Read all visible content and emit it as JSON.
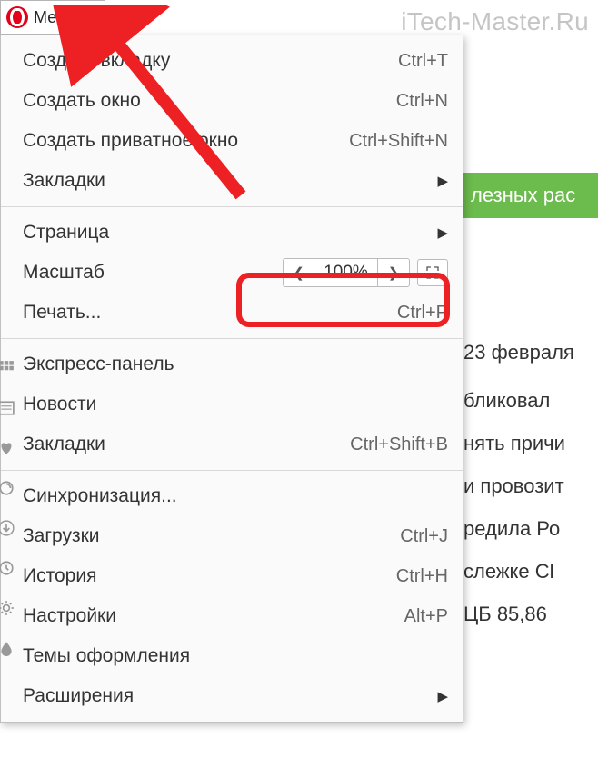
{
  "watermark": "iTech-Master.Ru",
  "menuButton": {
    "label": "Меню"
  },
  "background": {
    "banner": "лезных рас",
    "date": "23 февраля",
    "fragments": [
      "бликовал",
      "нять причи",
      "и провозит",
      "редила Ро",
      "слежке Cl",
      "ЦБ 85,86"
    ]
  },
  "menu": {
    "group1": [
      {
        "label": "Создать вкладку",
        "shortcut": "Ctrl+T"
      },
      {
        "label": "Создать окно",
        "shortcut": "Ctrl+N"
      },
      {
        "label": "Создать приватное окно",
        "shortcut": "Ctrl+Shift+N"
      },
      {
        "label": "Закладки",
        "submenu": true
      }
    ],
    "group2": {
      "page": {
        "label": "Страница",
        "submenu": true
      },
      "zoom": {
        "label": "Масштаб",
        "value": "100%"
      },
      "print": {
        "label": "Печать...",
        "shortcut": "Ctrl+P"
      }
    },
    "group3": [
      {
        "label": "Экспресс-панель",
        "icon": "grid"
      },
      {
        "label": "Новости",
        "icon": "news"
      },
      {
        "label": "Закладки",
        "shortcut": "Ctrl+Shift+B",
        "icon": "heart"
      }
    ],
    "group4": [
      {
        "label": "Синхронизация...",
        "icon": "sync"
      },
      {
        "label": "Загрузки",
        "shortcut": "Ctrl+J",
        "icon": "download"
      },
      {
        "label": "История",
        "shortcut": "Ctrl+H",
        "icon": "history"
      },
      {
        "label": "Настройки",
        "shortcut": "Alt+P",
        "icon": "settings"
      },
      {
        "label": "Темы оформления",
        "icon": "themes"
      },
      {
        "label": "Расширения",
        "submenu": true
      }
    ]
  }
}
